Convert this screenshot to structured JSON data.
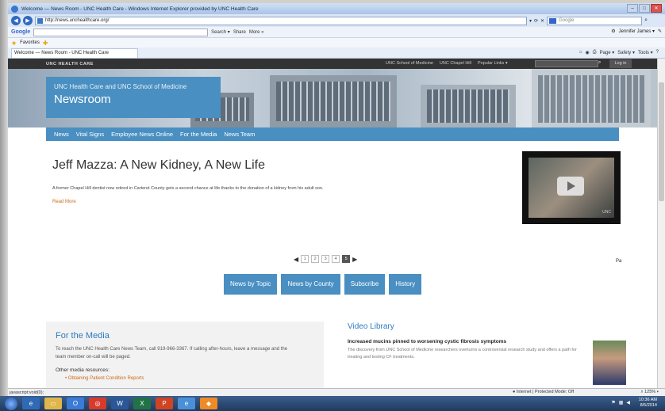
{
  "browser": {
    "window_title": "Welcome — News Room - UNC Health Care - Windows Internet Explorer provided by UNC Health Care",
    "url": "http://news.unchealthcare.org/",
    "search_placeholder": "Google",
    "addr_tools": [
      "▾",
      "⟳",
      "✕"
    ],
    "google_label": "Google",
    "google_tools": [
      "Search ▾",
      "Share",
      "More »"
    ],
    "google_user": "Jennifer James ▾",
    "favorites_label": "Favorites",
    "tab_title": "Welcome — News Room - UNC Health Care",
    "command_bar": [
      "Page ▾",
      "Safety ▾",
      "Tools ▾"
    ],
    "status_left": "javascript:void(0);",
    "status_zone": "Internet | Protected Mode: Off",
    "status_zoom": "125%",
    "clock_time": "10:36 AM",
    "clock_date": "8/5/2014"
  },
  "site": {
    "brand": "UNC HEALTH CARE",
    "top_links": [
      "UNC School of Medicine",
      "UNC Chapel Hill",
      "Popular Links ▾"
    ],
    "login_label": "Log in",
    "hero_subtitle": "UNC Health Care and UNC School of Medicine",
    "hero_title": "Newsroom",
    "nav": [
      "News",
      "Vital Signs",
      "Employee News Online",
      "For the Media",
      "News Team"
    ]
  },
  "story": {
    "title": "Jeff Mazza: A New Kidney, A New Life",
    "body": "A former Chapel Hill dentist now retired in Carteret County gets a second chance at life thanks to the donation of a kidney from his adult son.",
    "read_more": "Read More",
    "video_logo": "UNC"
  },
  "pager": {
    "pages": [
      "1",
      "2",
      "3",
      "4",
      "5"
    ],
    "active_index": 4
  },
  "cursor_text": "Pa",
  "buttons": [
    "News by Topic",
    "News by County",
    "Subscribe",
    "History"
  ],
  "media": {
    "title": "For the Media",
    "text": "To reach the UNC Health Care News Team, call 919-966-3367. If calling after-hours, leave a message and the team member on-call will be paged.",
    "sub": "Other media resources:",
    "link": "Obtaining Patient Condition Reports"
  },
  "video_library": {
    "title": "Video Library",
    "headline": "Increased mucins pinned to worsening cystic fibrosis symptoms",
    "text": "The discovery from UNC School of Medicine researchers overturns a controversial research study and offers a path for treating and testing CF treatments."
  },
  "colors": {
    "accent": "#4a8fc2",
    "link_orange": "#cc6a1a",
    "heading_blue": "#2c7bbf"
  }
}
